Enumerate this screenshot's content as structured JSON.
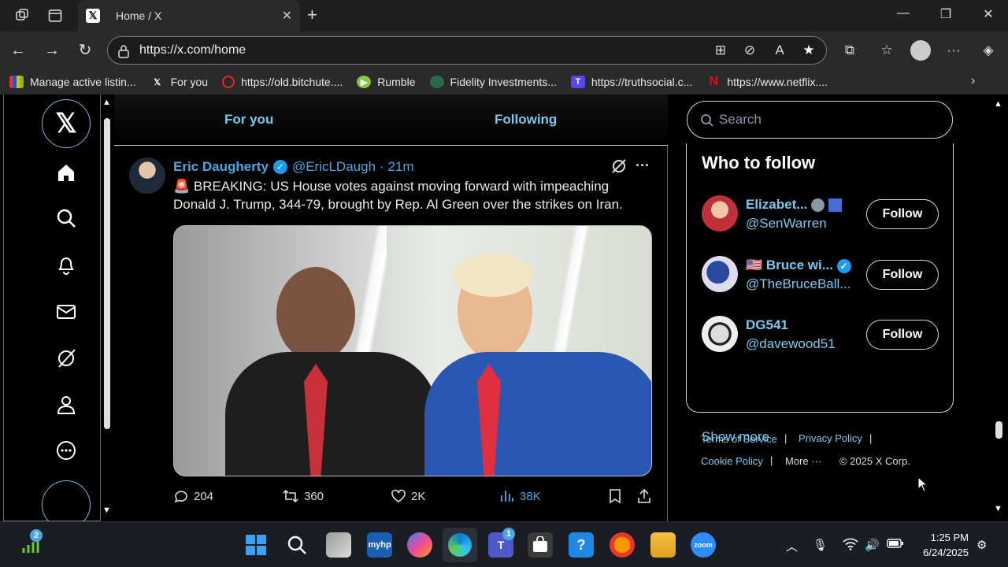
{
  "browser": {
    "tab_title": "Home / X",
    "url": "https://x.com/home",
    "bookmarks": [
      {
        "label": "Manage active listin...",
        "icon": "ebay-icon"
      },
      {
        "label": "For you",
        "icon": "x-icon"
      },
      {
        "label": "https://old.bitchute....",
        "icon": "bitchute-icon"
      },
      {
        "label": "Rumble",
        "icon": "rumble-icon"
      },
      {
        "label": "Fidelity Investments...",
        "icon": "fidelity-icon"
      },
      {
        "label": "https://truthsocial.c...",
        "icon": "truthsocial-icon"
      },
      {
        "label": "https://www.netflix....",
        "icon": "netflix-icon"
      }
    ]
  },
  "feed": {
    "tabs": {
      "for_you": "For you",
      "following": "Following"
    },
    "tweet": {
      "name": "Eric Daugherty",
      "handle": "@EricLDaugh",
      "time": "· 21m",
      "text": "🚨 BREAKING: US House votes against moving forward with impeaching Donald J. Trump, 344-79, brought by Rep. Al Green over the strikes on Iran.",
      "replies": "204",
      "reposts": "360",
      "likes": "2K",
      "views": "38K"
    }
  },
  "sidebar": {
    "search_placeholder": "Search",
    "who_to_follow": "Who to follow",
    "people": [
      {
        "name": "Elizabet...",
        "handle": "@SenWarren",
        "button": "Follow"
      },
      {
        "name": "🇺🇸 Bruce wi...",
        "handle": "@TheBruceBall...",
        "button": "Follow"
      },
      {
        "name": "DG541",
        "handle": "@davewood51",
        "button": "Follow"
      }
    ],
    "show_more": "Show more",
    "footer": {
      "terms": "Terms of Service",
      "privacy": "Privacy Policy",
      "cookie": "Cookie Policy",
      "more": "More ···",
      "copyright": "© 2025 X Corp."
    }
  },
  "taskbar": {
    "time": "1:25 PM",
    "date": "6/24/2025",
    "stock_badge": "2",
    "teams_badge": "1"
  }
}
